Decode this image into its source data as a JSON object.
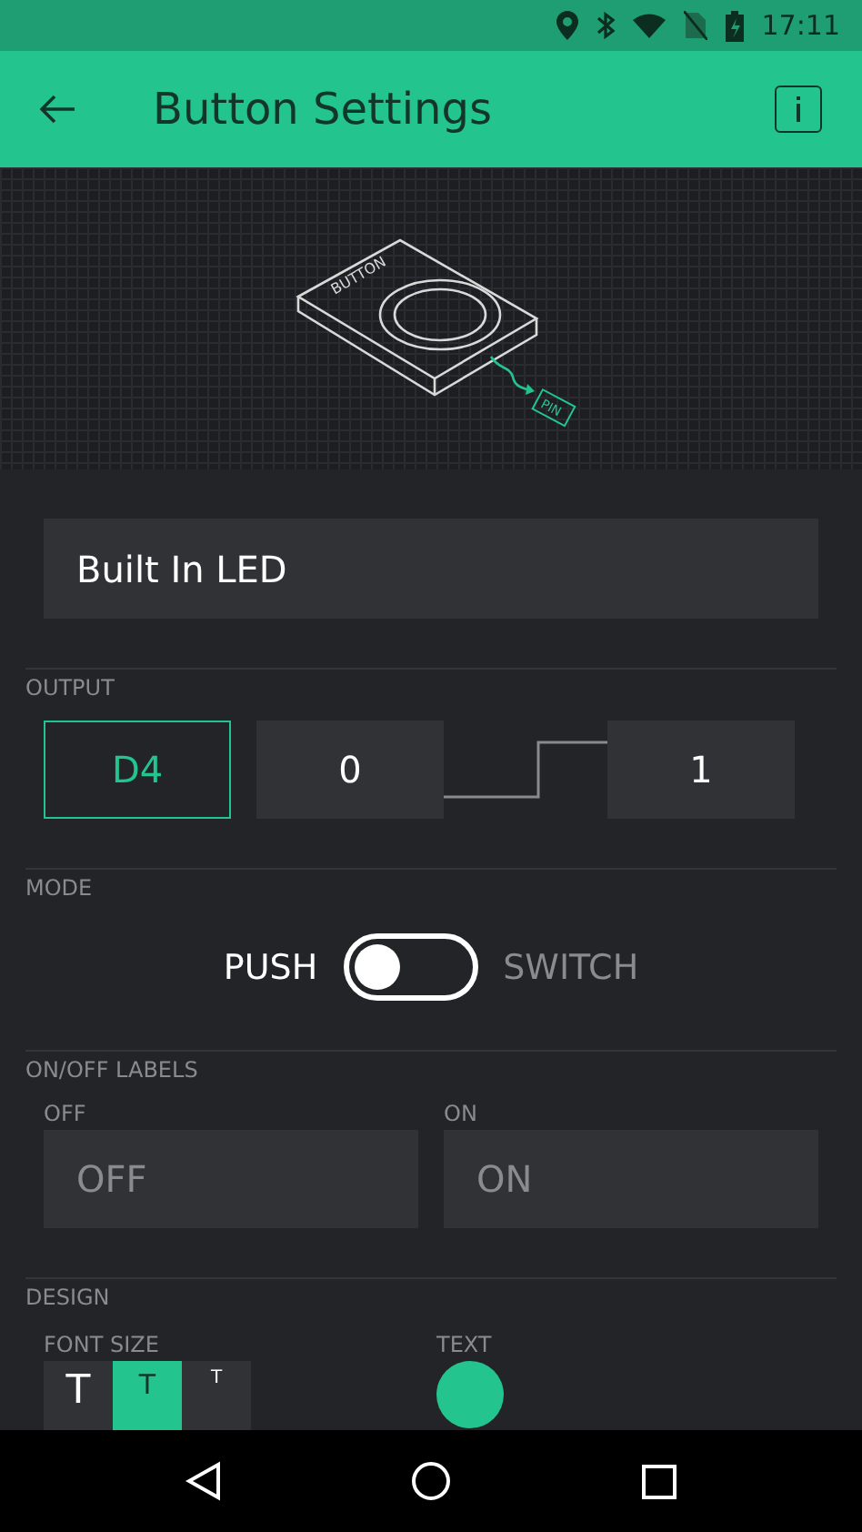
{
  "status_bar": {
    "time": "17:11"
  },
  "app_bar": {
    "title": "Button Settings"
  },
  "illustration": {
    "device_label": "BUTTON",
    "pin_label": "PIN"
  },
  "name_field": {
    "value": "Built In LED"
  },
  "output": {
    "label": "OUTPUT",
    "pin": "D4",
    "low": "0",
    "high": "1"
  },
  "mode": {
    "label": "MODE",
    "options": [
      {
        "label": "PUSH",
        "selected": true
      },
      {
        "label": "SWITCH",
        "selected": false
      }
    ]
  },
  "labels": {
    "title": "ON/OFF LABELS",
    "fields": [
      {
        "label": "OFF",
        "placeholder": "OFF"
      },
      {
        "label": "ON",
        "placeholder": "ON"
      }
    ]
  },
  "design": {
    "title": "DESIGN",
    "font_size": {
      "label": "FONT SIZE",
      "options": [
        {
          "label": "T",
          "selected": false
        },
        {
          "label": "T",
          "selected": true
        },
        {
          "label": "T",
          "selected": false
        }
      ]
    },
    "text_color": {
      "label": "TEXT",
      "color": "#23c48e"
    }
  }
}
